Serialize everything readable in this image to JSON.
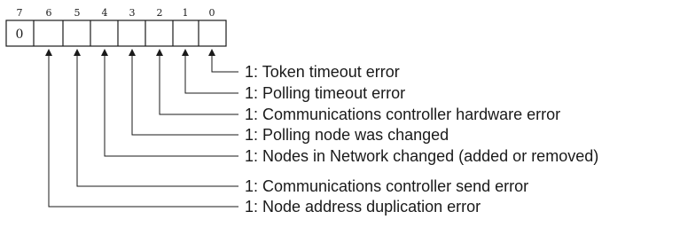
{
  "register": {
    "bit_numbers": [
      "7",
      "6",
      "5",
      "4",
      "3",
      "2",
      "1",
      "0"
    ],
    "bit7_value": "0"
  },
  "legend": [
    {
      "bit": "0",
      "text": "1: Token timeout error"
    },
    {
      "bit": "1",
      "text": "1: Polling timeout error"
    },
    {
      "bit": "2",
      "text": "1: Communications controller hardware error"
    },
    {
      "bit": "3",
      "text": "1: Polling node was changed"
    },
    {
      "bit": "4",
      "text": "1: Nodes in Network changed (added or removed)"
    },
    {
      "bit": "5",
      "text": "1: Communications controller send error"
    },
    {
      "bit": "6",
      "text": "1: Node address duplication error"
    }
  ],
  "colors": {
    "line": "#1a1a1a",
    "text": "#1a1a1a"
  }
}
